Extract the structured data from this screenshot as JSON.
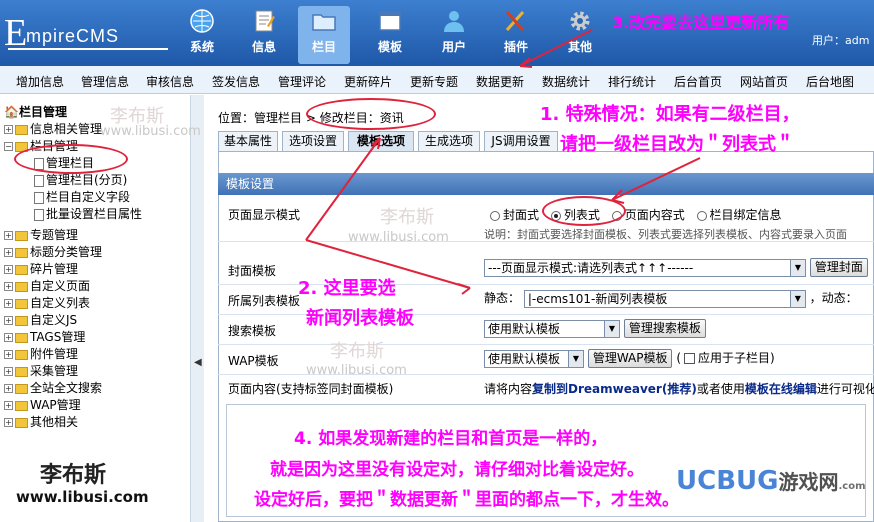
{
  "logo_text": "mpireCMS",
  "logo_initial": "E",
  "main_tabs": [
    {
      "label": "系统",
      "icon": "globe-icon"
    },
    {
      "label": "信息",
      "icon": "document-icon"
    },
    {
      "label": "栏目",
      "icon": "folder-icon"
    },
    {
      "label": "模板",
      "icon": "window-icon"
    },
    {
      "label": "用户",
      "icon": "user-icon"
    },
    {
      "label": "插件",
      "icon": "tools-icon"
    },
    {
      "label": "其他",
      "icon": "gear-icon"
    }
  ],
  "user_label": "用户：adm",
  "sub_nav": [
    "增加信息",
    "管理信息",
    "审核信息",
    "签发信息",
    "管理评论",
    "更新碎片",
    "更新专题",
    "数据更新",
    "数据统计",
    "排行统计",
    "后台首页",
    "网站首页",
    "后台地图"
  ],
  "sidebar": {
    "title": "栏目管理",
    "n1": "信息相关管理",
    "n2": "栏目管理",
    "n2a": "管理栏目",
    "n2b": "管理栏目(分页)",
    "n2c": "栏目自定义字段",
    "n2d": "批量设置栏目属性",
    "n3": "专题管理",
    "n4": "标题分类管理",
    "n5": "碎片管理",
    "n6": "自定义页面",
    "n7": "自定义列表",
    "n8": "自定义JS",
    "n9": "TAGS管理",
    "n10": "附件管理",
    "n11": "采集管理",
    "n12": "全站全文搜索",
    "n13": "WAP管理",
    "n14": "其他相关",
    "brand": "李布斯",
    "brand_url": "www.libusi.com"
  },
  "breadcrumb": {
    "prefix": "位置：",
    "link": "管理栏目",
    "sep": " > ",
    "current": "修改栏目：资讯"
  },
  "tabs": [
    "基本属性",
    "选项设置",
    "模板选项",
    "生成选项",
    "JS调用设置"
  ],
  "panel": {
    "header": "模板设置",
    "display_mode_label": "页面显示模式",
    "modes": [
      "封面式",
      "列表式",
      "页面内容式",
      "栏目绑定信息"
    ],
    "mode_note": "说明：封面式要选择封面模板、列表式要选择列表模板、内容式要录入页面",
    "cover_label": "封面模板",
    "cover_value": "---页面显示模式:请选列表式↑↑↑------",
    "cover_btn": "管理封面",
    "list_label": "所属列表模板",
    "list_static": "静态：",
    "list_value": "|-ecms101-新闻列表模板",
    "list_dynamic": "，动态：",
    "search_label": "搜索模板",
    "search_value": "使用默认模板",
    "search_btn": "管理搜索模板",
    "wap_label": "WAP模板",
    "wap_value": "使用默认模板",
    "wap_btn": "管理WAP模板",
    "wap_paren_open": "(",
    "wap_apply": "应用于子栏目)",
    "content_label": "页面内容(支持标签同封面模板)",
    "content_note_a": "请将内容",
    "content_note_b": "复制到Dreamweaver(推荐)",
    "content_note_c": "或者使用",
    "content_note_d": "模板在线编辑",
    "content_note_e": "进行可视化"
  },
  "annotations": {
    "a1_line1": "1. 特殊情况：如果有二级栏目，",
    "a1_line2": "请把一级栏目改为＂列表式＂",
    "a2_line1": "2. 这里要选",
    "a2_line2": "新闻列表模板",
    "a3": "3.改完要去这里更新所有",
    "a4_line1": "4. 如果发现新建的栏目和首页是一样的，",
    "a4_line2": "就是因为这里没有设定对，请仔细对比着设定好。",
    "a4_line3": "设定好后，要把＂数据更新＂里面的都点一下，才生效。"
  },
  "watermarks": {
    "cn": "李布斯",
    "url": "www.libusi.com",
    "ucbug": "UCBUG",
    "ucbug_cn": "游戏网",
    "ucbug_url": ".com"
  },
  "colors": {
    "annotation": "#ff00ff",
    "annotation_outline": "#e0233c",
    "topbar": "#2a66b6"
  }
}
